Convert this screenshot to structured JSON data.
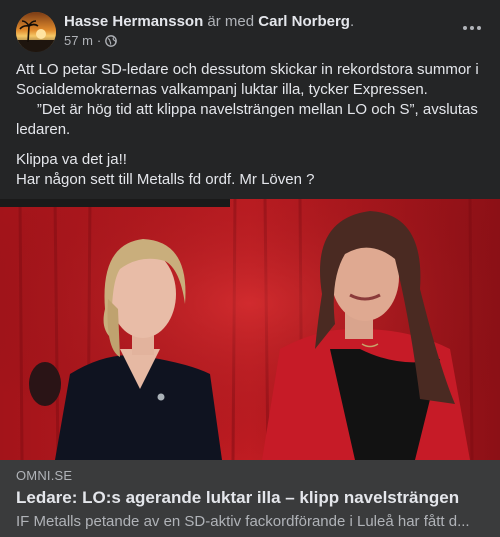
{
  "post": {
    "author": "Hasse Hermansson",
    "with_text": "är med",
    "tagged": "Carl Norberg",
    "tagged_suffix": ".",
    "time": "57 m",
    "separator": "·",
    "privacy_icon": "globe-icon",
    "menu_icon": "more-options-icon",
    "text_lines": [
      "Att LO petar SD-ledare och dessutom skickar in rekordstora summor i Socialdemokraternas valkampanj luktar illa, tycker Expressen.",
      "     ”Det är hög tid att klippa navelsträngen mellan LO och S”, avslutas ledaren."
    ],
    "comment_lines": [
      "Klippa va det ja!!",
      "Har någon sett till Metalls fd ordf. Mr Löven ?"
    ]
  },
  "link": {
    "domain": "OMNI.SE",
    "title": "Ledare: LO:s agerande luktar illa – klipp navelsträngen",
    "description": "IF Metalls petande av en SD-aktiv fackordförande i Luleå har fått d..."
  },
  "colors": {
    "background": "#242526",
    "card": "#3a3b3c",
    "text_primary": "#e4e6eb",
    "text_secondary": "#b0b3b8",
    "photo_backdrop": "#b0181c"
  }
}
